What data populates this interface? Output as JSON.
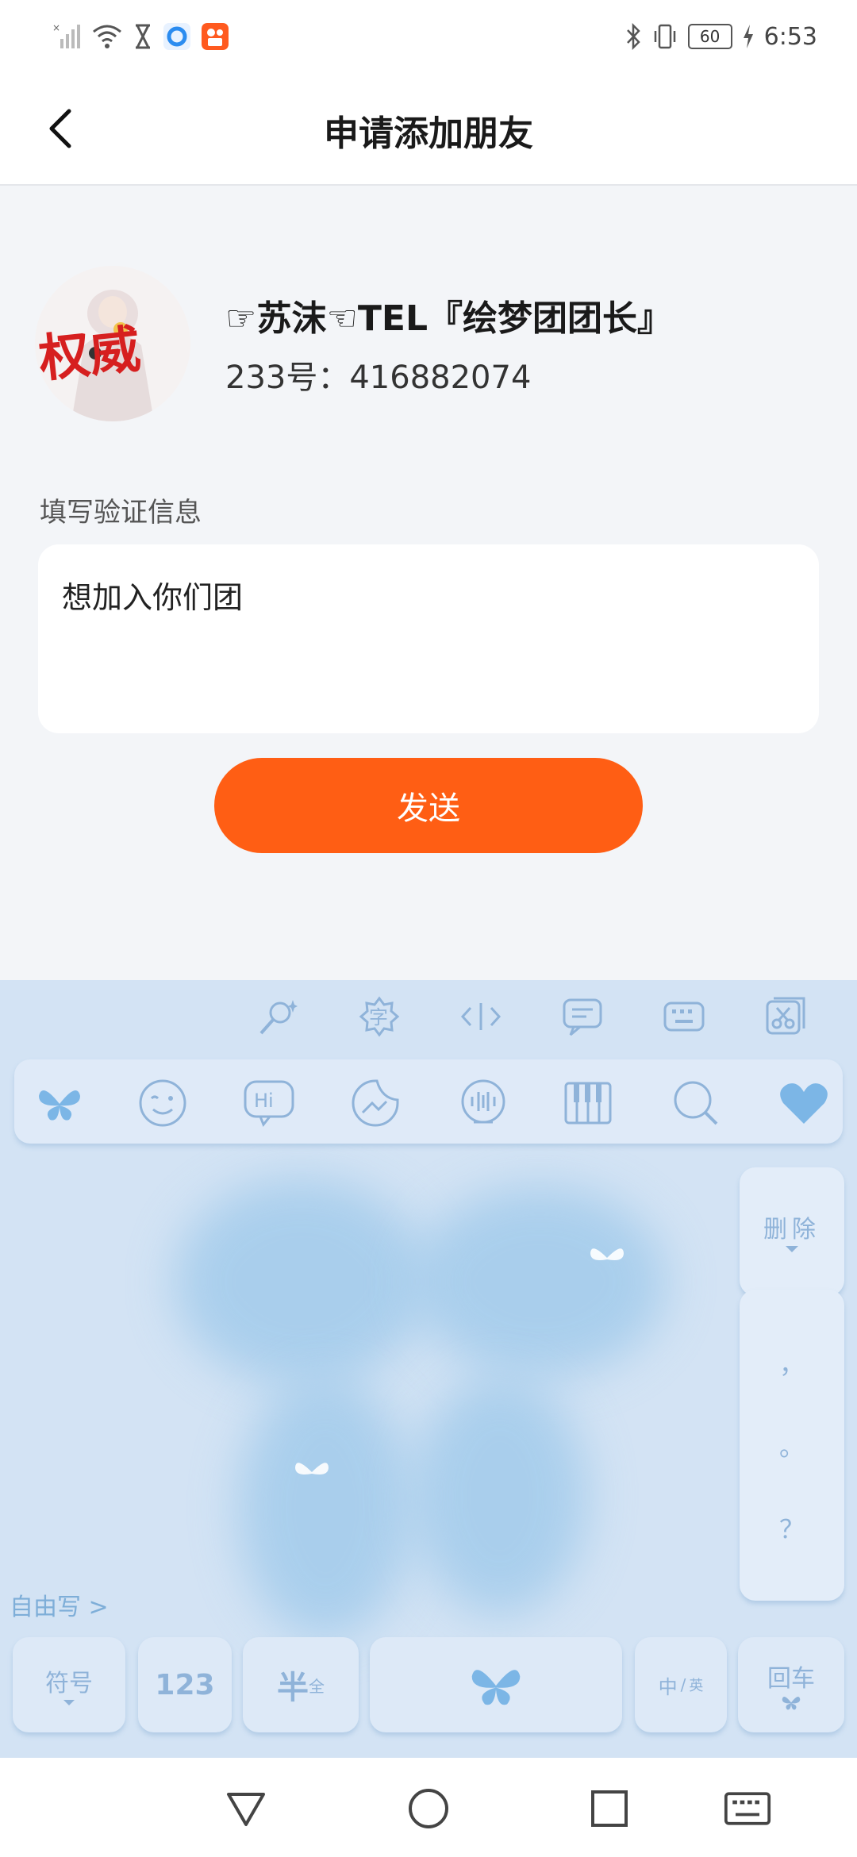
{
  "status_bar": {
    "time": "6:53",
    "battery": "60",
    "icons": [
      "no-sim-signal-icon",
      "wifi-icon",
      "hourglass-icon",
      "browser-app-icon",
      "kuaishou-app-icon",
      "bluetooth-icon",
      "vibrate-icon",
      "battery-icon",
      "charging-icon"
    ]
  },
  "header": {
    "title": "申请添加朋友",
    "back_icon": "chevron-left-icon"
  },
  "profile": {
    "nickname": "☞苏沫☜TEL『绘梦团团长』",
    "id_line": "233号：416882074",
    "avatar_text": "权威"
  },
  "form": {
    "label": "填写验证信息",
    "message": "想加入你们团",
    "send_label": "发送"
  },
  "keyboard": {
    "toolbar": [
      "magic-wand-icon",
      "font-char-icon",
      "cursor-move-icon",
      "clipboard-chat-icon",
      "keyboard-layout-icon",
      "scissors-icon"
    ],
    "toolbar_char": "字",
    "emoji_bar": [
      "butterfly-icon",
      "wink-face-icon",
      "hi-bubble-icon",
      "sticker-icon",
      "voice-icon",
      "piano-icon",
      "search-icon",
      "heart-icon"
    ],
    "hi_label": "Hi",
    "delete_label": "删除",
    "punct": [
      "，",
      "。",
      "？"
    ],
    "free_write": "自由写 >",
    "bottom_keys": {
      "symbols": "符号",
      "numbers": "123",
      "half": "半",
      "full": "全",
      "lang_cn": "中",
      "lang_en": "英",
      "enter": "回车"
    },
    "colors": {
      "accent": "#8fb3d9",
      "bg": "#d3e3f4"
    }
  },
  "nav": [
    "back-triangle-icon",
    "home-circle-icon",
    "recents-square-icon",
    "keyboard-hide-icon"
  ],
  "colors": {
    "primary": "#ff5e14",
    "page_bg": "#f3f5f8"
  }
}
